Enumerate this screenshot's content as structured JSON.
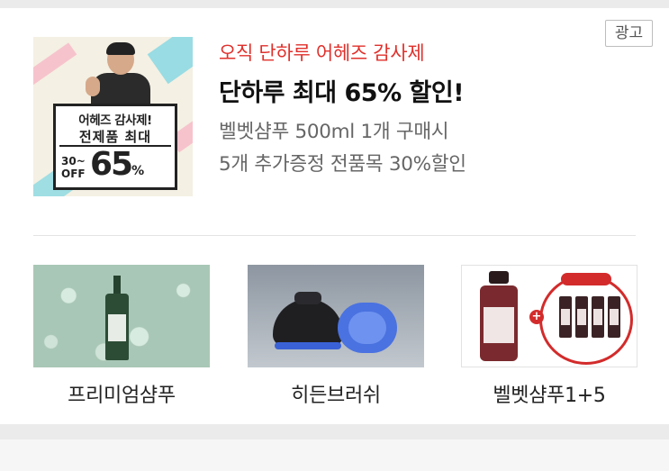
{
  "ad": {
    "badge": "광고"
  },
  "promo": {
    "thumbnail": {
      "line1": "어헤즈 감사제!",
      "line2": "전제품 최대",
      "small": "30~ OFF",
      "big": "65",
      "pct": "%"
    },
    "tagline": "오직 단하루 어헤즈 감사제",
    "title": "단하루 최대 65% 할인!",
    "desc_line1": "벨벳샴푸 500ml 1개 구매시",
    "desc_line2": "5개 추가증정 전품목 30%할인"
  },
  "products": [
    {
      "label": "프리미엄샴푸"
    },
    {
      "label": "히든브러쉬"
    },
    {
      "label": "벨벳샴푸1+5"
    }
  ],
  "colors": {
    "accent": "#e0302b",
    "title": "#111111",
    "desc": "#666666"
  }
}
